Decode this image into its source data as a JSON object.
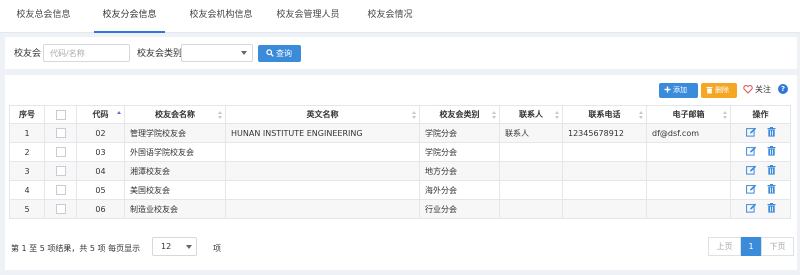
{
  "tabs": [
    {
      "label": "校友总会信息"
    },
    {
      "label": "校友分会信息"
    },
    {
      "label": "校友会机构信息"
    },
    {
      "label": "校友会管理人员"
    },
    {
      "label": "校友会情况"
    }
  ],
  "search": {
    "label_alumni": "校友会",
    "placeholder": "代码/名称",
    "label_category": "校友会类别",
    "category_value": "",
    "query_button": "查询"
  },
  "toolbar": {
    "add_label": "添加",
    "delete_label": "删除",
    "follow_label": "关注",
    "help_label": "?"
  },
  "table": {
    "headers": {
      "seq": "序号",
      "code": "代码",
      "name": "校友会名称",
      "english": "英文名称",
      "category": "校友会类别",
      "contact": "联系人",
      "phone": "联系电话",
      "email": "电子邮箱",
      "ops": "操作"
    },
    "rows": [
      {
        "seq": "1",
        "code": "02",
        "name": "管理学院校友会",
        "english": "HUNAN INSTITUTE ENGINEERING",
        "category": "学院分会",
        "contact": "联系人",
        "phone": "12345678912",
        "email": "df@dsf.com"
      },
      {
        "seq": "2",
        "code": "03",
        "name": "外国语学院校友会",
        "english": "",
        "category": "学院分会",
        "contact": "",
        "phone": "",
        "email": ""
      },
      {
        "seq": "3",
        "code": "04",
        "name": "湘潭校友会",
        "english": "",
        "category": "地方分会",
        "contact": "",
        "phone": "",
        "email": ""
      },
      {
        "seq": "4",
        "code": "05",
        "name": "美国校友会",
        "english": "",
        "category": "海外分会",
        "contact": "",
        "phone": "",
        "email": ""
      },
      {
        "seq": "5",
        "code": "06",
        "name": "制造业校友会",
        "english": "",
        "category": "行业分会",
        "contact": "",
        "phone": "",
        "email": ""
      }
    ]
  },
  "footer": {
    "summary": "第 1 至 5 项结果，共 5 项  每页显示",
    "page_size": "12",
    "unit": "项",
    "prev": "上页",
    "current_page": "1",
    "next": "下页"
  },
  "colors": {
    "accent": "#3b8bdb",
    "delete": "#f5a623",
    "active_tab_underline": "#2f78d8",
    "edit_icon": "#3b8bdb",
    "trash_icon": "#3b8bdb",
    "heart_icon": "#e05a5a"
  }
}
